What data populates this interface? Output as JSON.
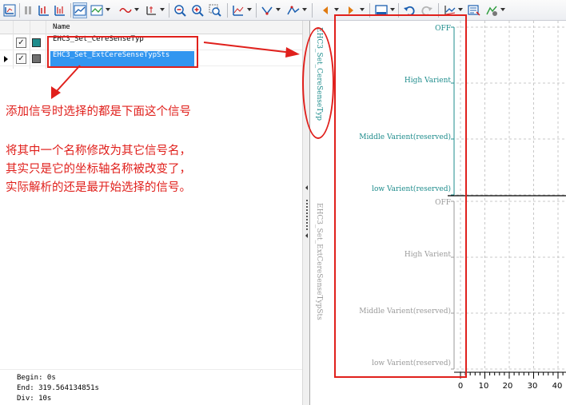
{
  "list": {
    "column_name": "Name",
    "signals": [
      {
        "name": "EHC3_Set_CereSenseTyp",
        "checked": true,
        "color": "#1e8c8c",
        "selected": false
      },
      {
        "name": "EHC3_Set_ExtCereSenseTypSts",
        "checked": true,
        "color": "#707070",
        "selected": true
      }
    ],
    "check_mark": "✓"
  },
  "annotations": {
    "line1": "添加信号时选择的都是下面这个信号",
    "line2": "将其中一个名称修改为其它信号名，",
    "line3": "其实只是它的坐标轴名称被改变了，",
    "line4": "实际解析的还是最开始选择的信号。"
  },
  "info": {
    "begin": "Begin: 0s",
    "end": "End: 319.564134851s",
    "div": "Div: 10s"
  },
  "colors": {
    "accent_red": "#e0201c",
    "teal": "#1e8c8c",
    "grey_axis": "#9a9a9a",
    "selection": "#3296f0"
  },
  "chart_data": {
    "type": "line",
    "panels": [
      {
        "axis_title": "EHC3_Set_CereSenseTyp",
        "color": "#1e8c8c",
        "levels": [
          "OFF",
          "High Varient",
          "Middle Varient(reserved)",
          "low Varient(reserved)"
        ]
      },
      {
        "axis_title": "EHC3_Set_ExtCereSenseTypSts",
        "color": "#9a9a9a",
        "levels": [
          "OFF",
          "High Varient",
          "Middle Varient(reserved)",
          "low Varient(reserved)"
        ]
      }
    ],
    "x_ticks": [
      "0",
      "10",
      "20",
      "30",
      "40"
    ],
    "x_div": 10,
    "grid": true
  }
}
